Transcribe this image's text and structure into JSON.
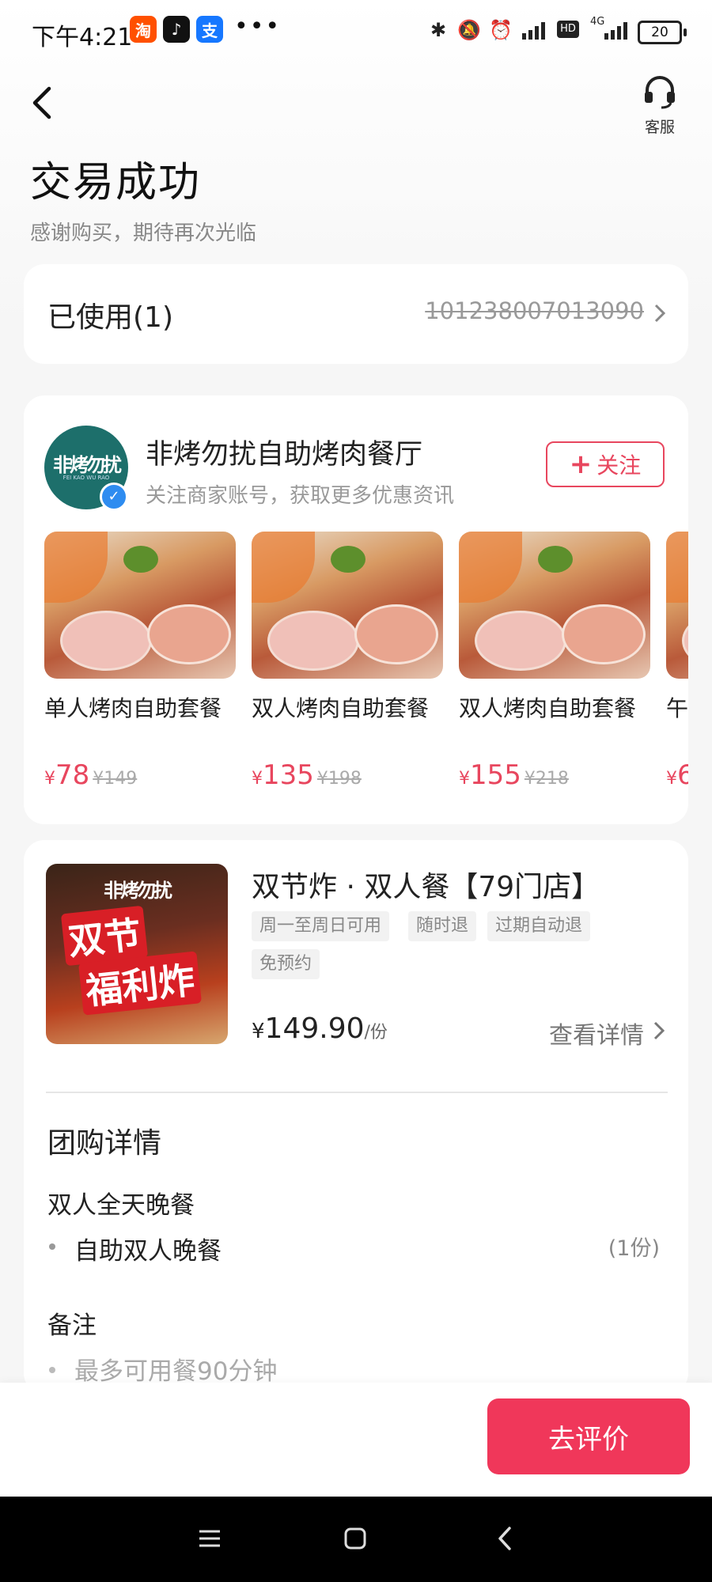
{
  "status_bar": {
    "time": "下午4:21",
    "apps": [
      {
        "name": "taobao",
        "glyph": "淘",
        "color": "#ff5000"
      },
      {
        "name": "douyin",
        "glyph": "♪",
        "color": "#111111"
      },
      {
        "name": "alipay",
        "glyph": "支",
        "color": "#1677ff"
      }
    ],
    "more": "•••",
    "network": "4G",
    "hd": "HD",
    "battery": "20"
  },
  "header": {
    "customer_service_label": "客服",
    "title": "交易成功",
    "subtitle": "感谢购买，期待再次光临"
  },
  "coupon": {
    "used_label": "已使用(1)",
    "code": "101238007013090"
  },
  "merchant": {
    "logo_text": "非烤勿扰",
    "logo_sub": "FEI KAO WU RAO",
    "name": "非烤勿扰自助烤肉餐厅",
    "subtitle": "关注商家账号，获取更多优惠资讯",
    "follow_plus": "+",
    "follow_label": "关注"
  },
  "products": [
    {
      "name": "单人烤肉自助套餐",
      "yen": "¥",
      "price": "78",
      "original": "¥149"
    },
    {
      "name": "双人烤肉自助套餐",
      "yen": "¥",
      "price": "135",
      "original": "¥198"
    },
    {
      "name": "双人烤肉自助套餐",
      "yen": "¥",
      "price": "155",
      "original": "¥218"
    },
    {
      "name": "午",
      "yen": "¥",
      "price": "6",
      "original": ""
    }
  ],
  "deal": {
    "image_brand": "非烤勿扰",
    "image_line1": "双节",
    "image_line2": "福利炸",
    "title": "双节炸 · 双人餐【79门店】",
    "tags": [
      "周一至周日可用",
      "随时退",
      "过期自动退",
      "免预约"
    ],
    "price_yen": "¥",
    "price": "149.90",
    "price_unit": "/份",
    "detail_link": "查看详情"
  },
  "group_buy": {
    "title": "团购详情",
    "package": "双人全天晚餐",
    "item": "自助双人晚餐",
    "qty": "(1份)",
    "note_title": "备注",
    "note_item": "最多可用餐90分钟"
  },
  "bottom": {
    "review_button": "去评价"
  }
}
